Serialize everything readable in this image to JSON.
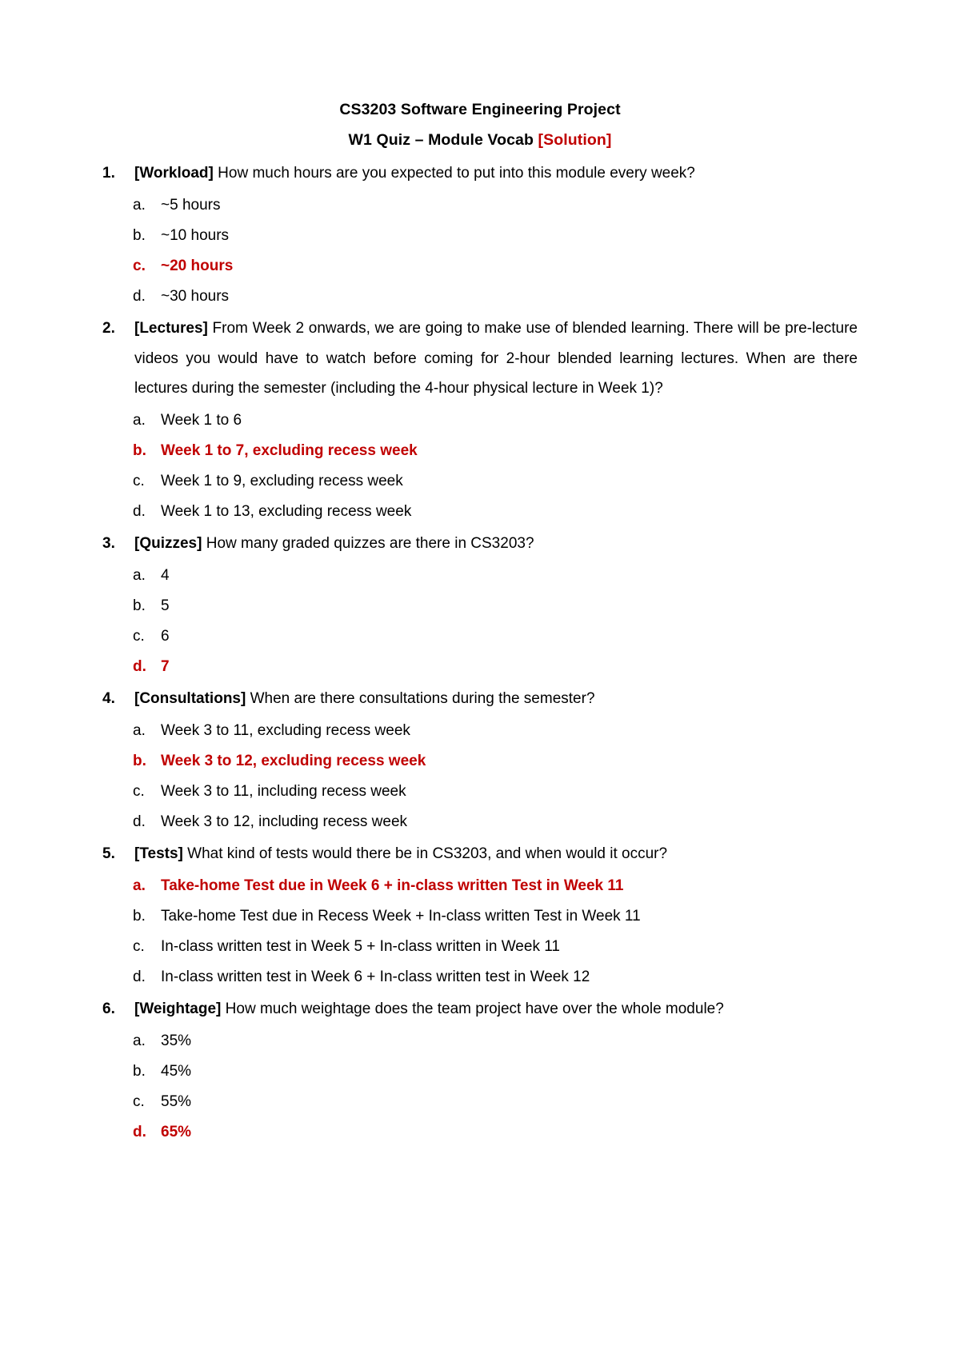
{
  "document": {
    "title": "CS3203 Software Engineering Project",
    "subtitle_main": "W1 Quiz – Module Vocab ",
    "subtitle_tag": "[Solution]"
  },
  "questions": [
    {
      "number": "1.",
      "tag": "[Workload]",
      "text": " How much hours are you expected to put into this module every week?",
      "options": [
        {
          "letter": "a.",
          "text": "~5 hours",
          "correct": false
        },
        {
          "letter": "b.",
          "text": "~10 hours",
          "correct": false
        },
        {
          "letter": "c.",
          "text": "~20 hours",
          "correct": true
        },
        {
          "letter": "d.",
          "text": "~30 hours",
          "correct": false
        }
      ]
    },
    {
      "number": "2.",
      "tag": "[Lectures]",
      "text": " From Week 2 onwards, we are going to make use of blended learning. There will be pre-lecture videos you would have to watch before coming for 2-hour blended learning lectures. When are there lectures during the semester (including the 4-hour physical lecture in Week 1)?",
      "options": [
        {
          "letter": "a.",
          "text": "Week 1 to 6",
          "correct": false
        },
        {
          "letter": "b.",
          "text": "Week 1 to 7, excluding recess week",
          "correct": true
        },
        {
          "letter": "c.",
          "text": "Week 1 to 9, excluding recess week",
          "correct": false
        },
        {
          "letter": "d.",
          "text": "Week 1 to 13, excluding recess week",
          "correct": false
        }
      ]
    },
    {
      "number": "3.",
      "tag": "[Quizzes]",
      "text": " How many graded quizzes are there in CS3203?",
      "options": [
        {
          "letter": "a.",
          "text": "4",
          "correct": false
        },
        {
          "letter": "b.",
          "text": "5",
          "correct": false
        },
        {
          "letter": "c.",
          "text": "6",
          "correct": false
        },
        {
          "letter": "d.",
          "text": "7",
          "correct": true
        }
      ]
    },
    {
      "number": "4.",
      "tag": "[Consultations]",
      "text": " When are there consultations during the semester?",
      "options": [
        {
          "letter": "a.",
          "text": "Week 3 to 11, excluding recess week",
          "correct": false
        },
        {
          "letter": "b.",
          "text": "Week 3 to 12, excluding recess week",
          "correct": true
        },
        {
          "letter": "c.",
          "text": "Week 3 to 11, including recess week",
          "correct": false
        },
        {
          "letter": "d.",
          "text": "Week 3 to 12, including recess week",
          "correct": false
        }
      ]
    },
    {
      "number": "5.",
      "tag": "[Tests]",
      "text": " What kind of tests would there be in CS3203, and when would it occur?",
      "options": [
        {
          "letter": "a.",
          "text": "Take-home Test due in Week 6 + in-class written Test in Week 11",
          "correct": true
        },
        {
          "letter": "b.",
          "text": "Take-home Test due in Recess Week + In-class written Test in Week 11",
          "correct": false
        },
        {
          "letter": "c.",
          "text": "In-class written test in Week 5 + In-class written in Week 11",
          "correct": false
        },
        {
          "letter": "d.",
          "text": "In-class written test in Week 6 + In-class written test in Week 12",
          "correct": false
        }
      ]
    },
    {
      "number": "6.",
      "tag": "[Weightage]",
      "text": " How much weightage does the team project have over the whole module?",
      "options": [
        {
          "letter": "a.",
          "text": "35%",
          "correct": false
        },
        {
          "letter": "b.",
          "text": "45%",
          "correct": false
        },
        {
          "letter": "c.",
          "text": "55%",
          "correct": false
        },
        {
          "letter": "d.",
          "text": "65%",
          "correct": true
        }
      ]
    }
  ],
  "colors": {
    "answer_red": "#c00000",
    "body_text": "#000000",
    "page_background": "#ffffff"
  }
}
